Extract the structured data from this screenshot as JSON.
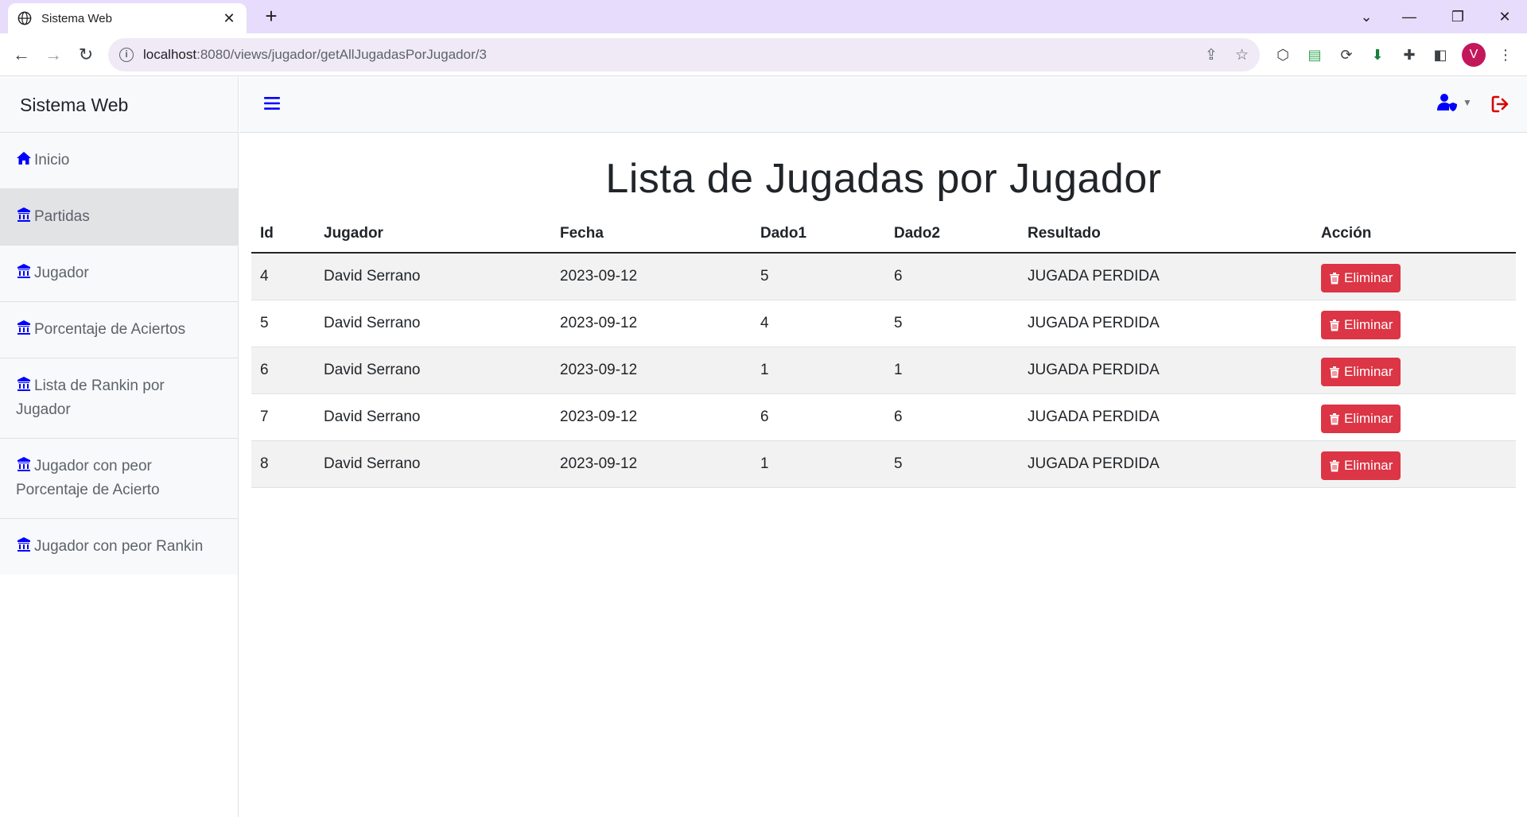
{
  "browser": {
    "tab_title": "Sistema Web",
    "url_host": "localhost",
    "url_rest": ":8080/views/jugador/getAllJugadasPorJugador/3",
    "profile_initial": "V",
    "colors": {
      "tabbar": "#e7dcfb",
      "profile": "#c2185b"
    }
  },
  "sidebar": {
    "brand": "Sistema Web",
    "items": [
      {
        "label": "Inicio",
        "icon": "home-icon",
        "active": false
      },
      {
        "label": "Partidas",
        "icon": "building-icon",
        "active": true
      },
      {
        "label": "Jugador",
        "icon": "building-icon",
        "active": false
      },
      {
        "label": "Porcentaje de Aciertos",
        "icon": "building-icon",
        "active": false
      },
      {
        "label": "Lista de Rankin por Jugador",
        "icon": "building-icon",
        "active": false
      },
      {
        "label": "Jugador con peor Porcentaje de Acierto",
        "icon": "building-icon",
        "active": false
      },
      {
        "label": "Jugador con peor Rankin",
        "icon": "building-icon",
        "active": false
      }
    ]
  },
  "header": {
    "icons": [
      "hamburger-icon",
      "user-shield-icon",
      "logout-icon"
    ],
    "colors": {
      "accent": "#0000ff",
      "logout": "#dc0000"
    }
  },
  "main": {
    "title": "Lista de Jugadas por Jugador",
    "columns": [
      "Id",
      "Jugador",
      "Fecha",
      "Dado1",
      "Dado2",
      "Resultado",
      "Acción"
    ],
    "rows": [
      {
        "id": "4",
        "jugador": "David Serrano",
        "fecha": "2023-09-12",
        "dado1": "5",
        "dado2": "6",
        "resultado": "JUGADA PERDIDA",
        "accion": "Eliminar"
      },
      {
        "id": "5",
        "jugador": "David Serrano",
        "fecha": "2023-09-12",
        "dado1": "4",
        "dado2": "5",
        "resultado": "JUGADA PERDIDA",
        "accion": "Eliminar"
      },
      {
        "id": "6",
        "jugador": "David Serrano",
        "fecha": "2023-09-12",
        "dado1": "1",
        "dado2": "1",
        "resultado": "JUGADA PERDIDA",
        "accion": "Eliminar"
      },
      {
        "id": "7",
        "jugador": "David Serrano",
        "fecha": "2023-09-12",
        "dado1": "6",
        "dado2": "6",
        "resultado": "JUGADA PERDIDA",
        "accion": "Eliminar"
      },
      {
        "id": "8",
        "jugador": "David Serrano",
        "fecha": "2023-09-12",
        "dado1": "1",
        "dado2": "5",
        "resultado": "JUGADA PERDIDA",
        "accion": "Eliminar"
      }
    ],
    "colors": {
      "delete_button": "#dc3545",
      "striped_row": "#f2f2f2"
    }
  }
}
